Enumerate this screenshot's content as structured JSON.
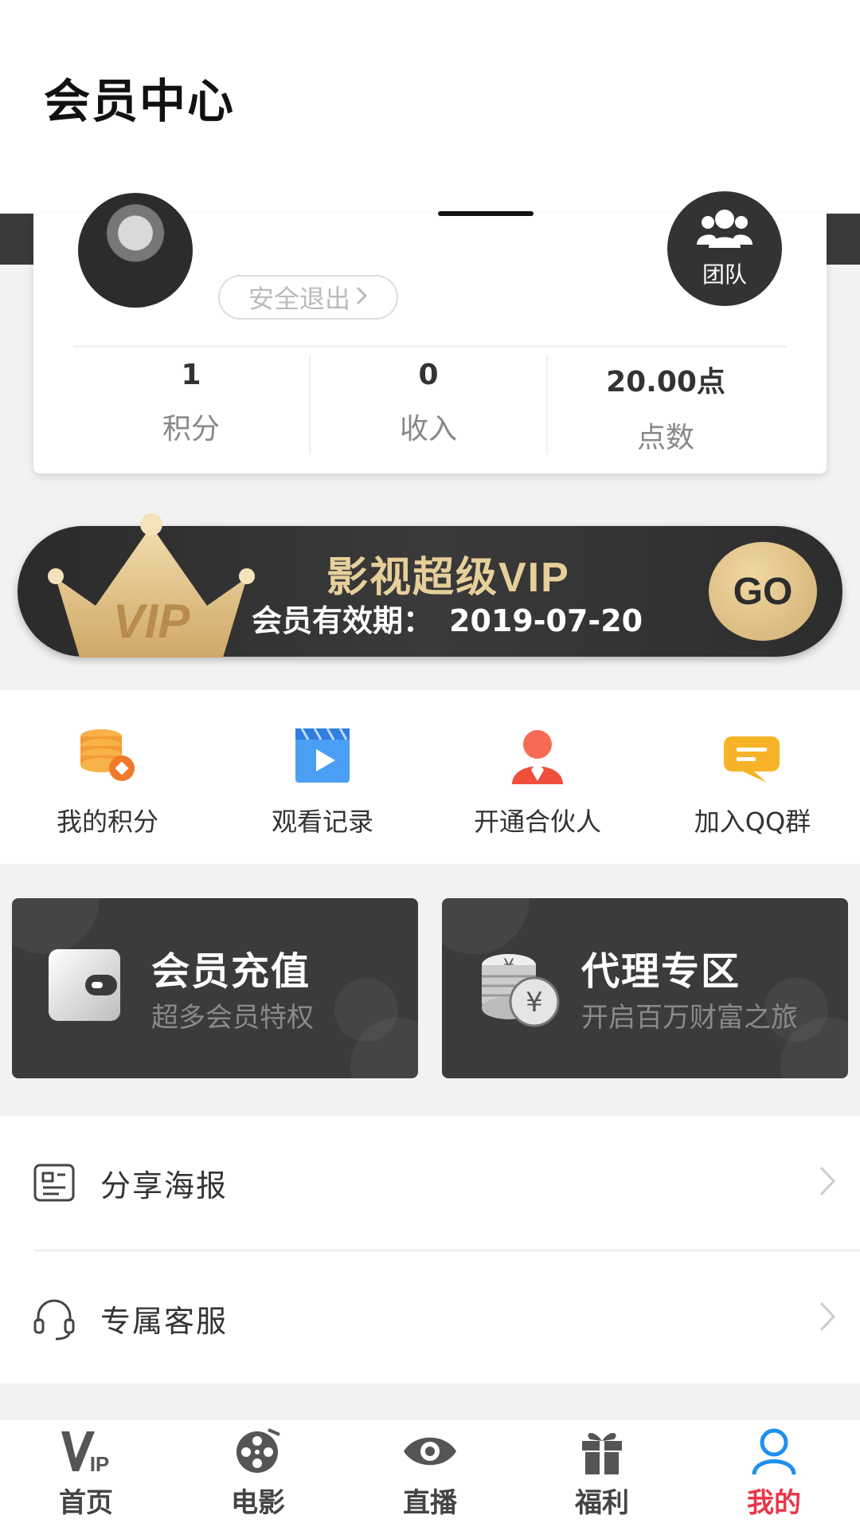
{
  "header": {
    "title": "会员中心"
  },
  "profile": {
    "logout_label": "安全退出",
    "team_label": "团队",
    "stats": [
      {
        "value": "1",
        "label": "积分"
      },
      {
        "value": "0",
        "label": "收入"
      },
      {
        "value": "20.00点",
        "label": "点数"
      }
    ]
  },
  "vip_banner": {
    "crown_text": "VIP",
    "title": "影视超级VIP",
    "expiry_label": "会员有效期：",
    "expiry_date": "2019-07-20",
    "go_label": "GO"
  },
  "quick_actions": [
    {
      "label": "我的积分",
      "icon": "coins-stack-icon"
    },
    {
      "label": "观看记录",
      "icon": "video-play-icon"
    },
    {
      "label": "开通合伙人",
      "icon": "partner-person-icon"
    },
    {
      "label": "加入QQ群",
      "icon": "chat-bubble-icon"
    }
  ],
  "feature_cards": [
    {
      "title": "会员充值",
      "subtitle": "超多会员特权",
      "icon": "wallet-icon"
    },
    {
      "title": "代理专区",
      "subtitle": "开启百万财富之旅",
      "icon": "yuan-coins-icon"
    }
  ],
  "list_items": [
    {
      "label": "分享海报",
      "icon": "poster-icon"
    },
    {
      "label": "专属客服",
      "icon": "headset-icon"
    }
  ],
  "bottom_nav": [
    {
      "label": "首页",
      "icon": "vip-home-icon"
    },
    {
      "label": "电影",
      "icon": "film-reel-icon"
    },
    {
      "label": "直播",
      "icon": "eye-icon"
    },
    {
      "label": "福利",
      "icon": "gift-icon"
    },
    {
      "label": "我的",
      "icon": "user-icon",
      "active": true
    }
  ],
  "colors": {
    "accent_active": "#e8364a",
    "dark_card": "#3b3b3b",
    "gold": "#e6cf9a",
    "nav_active_icon": "#1f8ff0"
  }
}
